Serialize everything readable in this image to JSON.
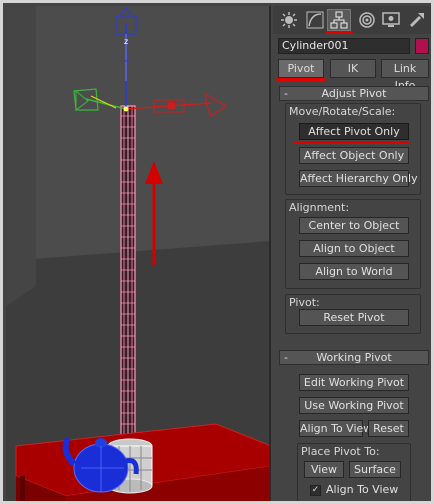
{
  "panel": {
    "tab_icons": [
      "sun-icon",
      "curve-icon",
      "hierarchy-icon",
      "motion-icon",
      "display-icon",
      "utilities-icon"
    ],
    "object_name": "Cylinder001",
    "object_color": "#b10f4d",
    "subtabs": {
      "pivot": "Pivot",
      "ik": "IK",
      "link_info": "Link Info"
    },
    "adjust_pivot": {
      "title": "Adjust Pivot",
      "move_group_label": "Move/Rotate/Scale:",
      "affect_pivot_only": "Affect Pivot Only",
      "affect_object_only": "Affect Object Only",
      "affect_hierarchy_only": "Affect Hierarchy Only",
      "alignment_label": "Alignment:",
      "center_to_object": "Center to Object",
      "align_to_object": "Align to Object",
      "align_to_world": "Align to World",
      "pivot_label": "Pivot:",
      "reset_pivot": "Reset Pivot"
    },
    "working_pivot": {
      "title": "Working Pivot",
      "edit_working_pivot": "Edit Working Pivot",
      "use_working_pivot": "Use Working Pivot",
      "align_to_view": "Align To View",
      "reset": "Reset",
      "place_pivot_label": "Place Pivot To:",
      "view": "View",
      "surface": "Surface",
      "align_to_view_check": "Align To View",
      "align_to_view_checked": true
    },
    "minus_sign": "-"
  },
  "viewport": {
    "gizmo_axis_label": "z",
    "colors": {
      "background": "#4c4c4c",
      "floor": "#3c3c3c",
      "pole": "#ff9bbd",
      "table": "#b00000",
      "teapot": "#1a2ed8",
      "arrow": "#d40000",
      "gizmo_x": "#c62020",
      "gizmo_y": "#3bb53b",
      "gizmo_z": "#2a3ae0"
    }
  }
}
